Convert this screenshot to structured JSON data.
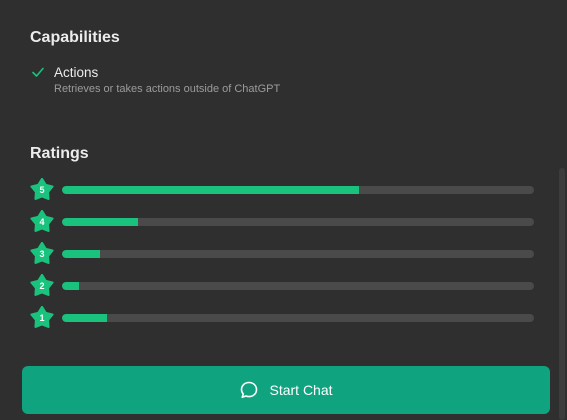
{
  "capabilities": {
    "title": "Capabilities",
    "items": [
      {
        "icon": "check-icon",
        "name": "Actions",
        "description": "Retrieves or takes actions outside of ChatGPT"
      }
    ]
  },
  "ratings": {
    "title": "Ratings",
    "rows": [
      {
        "stars": "5",
        "fraction": 0.63
      },
      {
        "stars": "4",
        "fraction": 0.16
      },
      {
        "stars": "3",
        "fraction": 0.08
      },
      {
        "stars": "2",
        "fraction": 0.035
      },
      {
        "stars": "1",
        "fraction": 0.095
      }
    ]
  },
  "footer": {
    "start_chat_label": "Start Chat",
    "icon": "chat-bubble-icon"
  },
  "colors": {
    "background": "#2f2f2f",
    "accent": "#19c37d",
    "button": "#10a37f",
    "track": "#4a4a4a",
    "secondary_text": "#9b9b9b"
  }
}
